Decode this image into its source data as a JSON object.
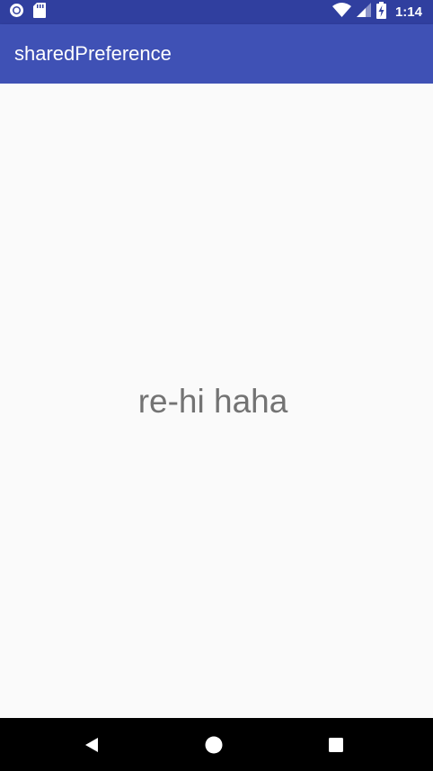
{
  "status_bar": {
    "time": "1:14",
    "icons": [
      "circle-notification-icon",
      "sd-card-icon",
      "wifi-icon",
      "cellular-signal-icon",
      "battery-charging-icon"
    ]
  },
  "app_bar": {
    "title": "sharedPreference"
  },
  "main": {
    "text": "re-hi haha"
  },
  "nav_bar": {
    "buttons": [
      "back",
      "home",
      "recents"
    ]
  },
  "colors": {
    "status_bar": "#303f9f",
    "app_bar": "#3f51b5",
    "background": "#fafafa",
    "text": "#737373",
    "nav_bar": "#000000"
  }
}
